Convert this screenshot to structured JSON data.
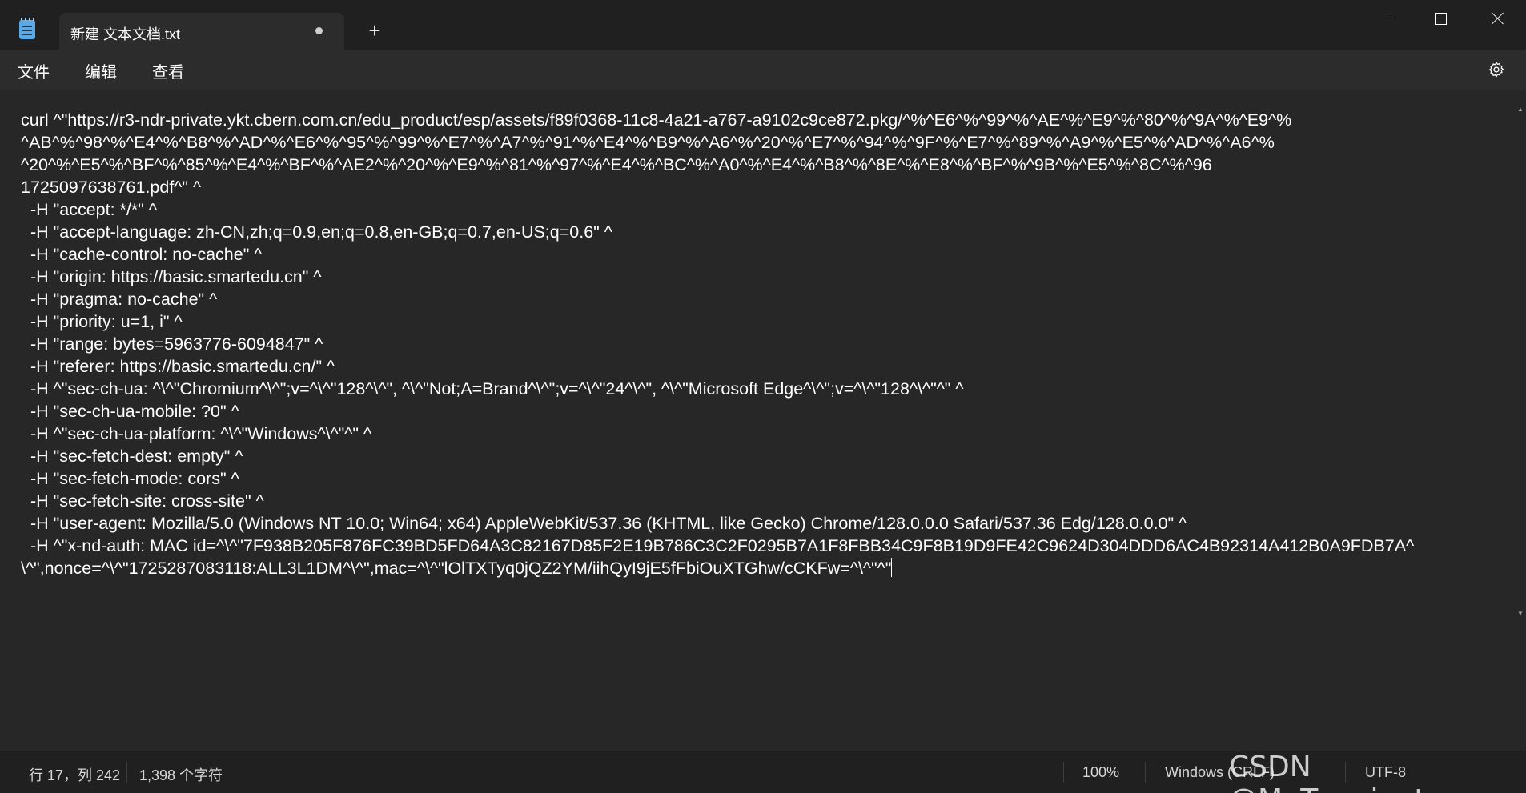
{
  "app": {
    "tab_title": "新建 文本文档.txt",
    "new_tab": "+",
    "icon": "notepad-icon"
  },
  "window_controls": {
    "minimize": "minimize-icon",
    "maximize": "maximize-icon",
    "close": "close-icon"
  },
  "menu": {
    "file": "文件",
    "edit": "编辑",
    "view": "查看",
    "settings_icon": "gear-icon"
  },
  "editor": {
    "content": "curl ^\"https://r3-ndr-private.ykt.cbern.com.cn/edu_product/esp/assets/f89f0368-11c8-4a21-a767-a9102c9ce872.pkg/^%^E6^%^99^%^AE^%^E9^%^80^%^9A^%^E9^%\n^AB^%^98^%^E4^%^B8^%^AD^%^E6^%^95^%^99^%^E7^%^A7^%^91^%^E4^%^B9^%^A6^%^20^%^E7^%^94^%^9F^%^E7^%^89^%^A9^%^E5^%^AD^%^A6^%\n^20^%^E5^%^BF^%^85^%^E4^%^BF^%^AE2^%^20^%^E9^%^81^%^97^%^E4^%^BC^%^A0^%^E4^%^B8^%^8E^%^E8^%^BF^%^9B^%^E5^%^8C^%^96\n1725097638761.pdf^\" ^\n  -H \"accept: */*\" ^\n  -H \"accept-language: zh-CN,zh;q=0.9,en;q=0.8,en-GB;q=0.7,en-US;q=0.6\" ^\n  -H \"cache-control: no-cache\" ^\n  -H \"origin: https://basic.smartedu.cn\" ^\n  -H \"pragma: no-cache\" ^\n  -H \"priority: u=1, i\" ^\n  -H \"range: bytes=5963776-6094847\" ^\n  -H \"referer: https://basic.smartedu.cn/\" ^\n  -H ^\"sec-ch-ua: ^\\^\"Chromium^\\^\";v=^\\^\"128^\\^\", ^\\^\"Not;A=Brand^\\^\";v=^\\^\"24^\\^\", ^\\^\"Microsoft Edge^\\^\";v=^\\^\"128^\\^\"^\" ^\n  -H \"sec-ch-ua-mobile: ?0\" ^\n  -H ^\"sec-ch-ua-platform: ^\\^\"Windows^\\^\"^\" ^\n  -H \"sec-fetch-dest: empty\" ^\n  -H \"sec-fetch-mode: cors\" ^\n  -H \"sec-fetch-site: cross-site\" ^\n  -H \"user-agent: Mozilla/5.0 (Windows NT 10.0; Win64; x64) AppleWebKit/537.36 (KHTML, like Gecko) Chrome/128.0.0.0 Safari/537.36 Edg/128.0.0.0\" ^\n  -H ^\"x-nd-auth: MAC id=^\\^\"7F938B205F876FC39BD5FD64A3C82167D85F2E19B786C3C2F0295B7A1F8FBB34C9F8B19D9FE42C9624D304DDD6AC4B92314A412B0A9FDB7A^\n\\^\",nonce=^\\^\"1725287083118:ALL3L1DM^\\^\",mac=^\\^\"lOlTXTyq0jQZ2YM/iihQyI9jE5fFbiOuXTGhw/cCKFw=^\\^\"^\""
  },
  "status": {
    "position": "行 17，列 242",
    "char_count": "1,398 个字符",
    "zoom": "100%",
    "line_ending": "Windows (CRLF)",
    "encoding": "UTF-8"
  },
  "watermark": "CSDN @MeTerminator"
}
